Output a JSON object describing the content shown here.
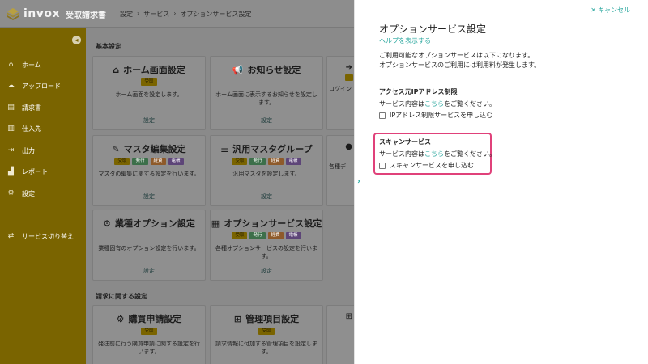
{
  "app": {
    "logo_text": "invox",
    "logo_sub": "受取請求書",
    "breadcrumb": [
      "設定",
      "サービス",
      "オプションサービス設定"
    ]
  },
  "sidebar": {
    "items": [
      {
        "label": "ホーム",
        "icon": "home-icon"
      },
      {
        "label": "アップロード",
        "icon": "cloud-upload-icon"
      },
      {
        "label": "請求書",
        "icon": "document-icon"
      },
      {
        "label": "仕入先",
        "icon": "building-icon"
      },
      {
        "label": "出力",
        "icon": "export-icon"
      },
      {
        "label": "レポート",
        "icon": "chart-icon"
      },
      {
        "label": "設定",
        "icon": "gear-icon"
      }
    ],
    "switch_label": "サービス切り替え"
  },
  "main": {
    "section_basic": "基本設定",
    "section_invoice": "請求に関する設定",
    "cards": [
      {
        "title": "ホーム画面設定",
        "badges": [
          "受取"
        ],
        "desc": "ホーム画面を設定します。",
        "link": "設定"
      },
      {
        "title": "お知らせ設定",
        "badges": [],
        "desc": "ホーム画面に表示するお知らせを設定します。",
        "link": "設定"
      },
      {
        "title": "マスタ編集設定",
        "badges": [
          "受取",
          "発行",
          "経費",
          "電帳"
        ],
        "desc": "マスタの編集に関する設定を行います。",
        "link": "設定"
      },
      {
        "title": "汎用マスタグループ",
        "badges": [
          "受取",
          "発行",
          "経費",
          "電帳"
        ],
        "desc": "汎用マスタを設定します。",
        "link": "設定"
      },
      {
        "title": "業種オプション設定",
        "badges": [],
        "desc": "業種固有のオプション設定を行います。",
        "link": "設定"
      },
      {
        "title": "オプションサービス設定",
        "badges": [
          "受取",
          "発行",
          "経費",
          "電帳"
        ],
        "desc": "各種オプションサービスの設定を行います。",
        "link": "設定"
      },
      {
        "title": "購買申請設定",
        "badges": [
          "受取"
        ],
        "desc": "発注前に行う購買申請に関する設定を行います。",
        "link": ""
      },
      {
        "title": "管理項目設定",
        "badges": [
          "受取"
        ],
        "desc": "請求情報に付加する管理項目を設定します。",
        "link": ""
      }
    ],
    "edge_texts": [
      "ログイン",
      "各種デ"
    ]
  },
  "panel": {
    "cancel_label": "キャンセル",
    "title": "オプションサービス設定",
    "help_link": "ヘルプを表示する",
    "intro_1": "ご利用可能なオプションサービスは以下になります。",
    "intro_2": "オプションサービスのご利用には利用料が発生します。",
    "ip_title": "アクセス元IPアドレス制限",
    "ip_line_pre": "サービス内容は",
    "ip_line_link": "こちら",
    "ip_line_post": "をご覧ください。",
    "ip_checkbox": "IPアドレス制限サービスを申し込む",
    "scan_title": "スキャンサービス",
    "scan_line_pre": "サービス内容は",
    "scan_line_link": "こちら",
    "scan_line_post": "をご覧ください。",
    "scan_checkbox": "スキャンサービスを申し込む"
  },
  "colors": {
    "accent": "#2aa79e",
    "brand": "#f5c800",
    "highlight": "#e0417a"
  }
}
